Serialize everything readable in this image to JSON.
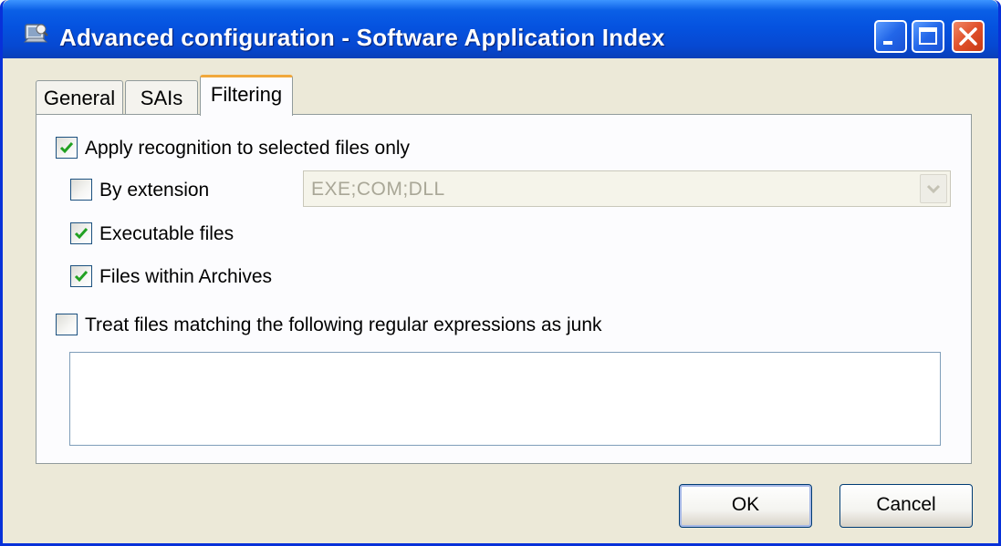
{
  "window": {
    "title": "Advanced configuration - Software Application Index",
    "app_icon": "sai-app-icon",
    "controls": [
      "minimize-icon",
      "maximize-icon",
      "close-icon"
    ]
  },
  "tabs": [
    {
      "label": "General",
      "selected": false
    },
    {
      "label": "SAIs",
      "selected": false
    },
    {
      "label": "Filtering",
      "selected": true
    }
  ],
  "filtering": {
    "apply_recognition": {
      "label": "Apply recognition to selected files only",
      "checked": true
    },
    "by_extension": {
      "label": "By extension",
      "checked": false,
      "value": "EXE;COM;DLL",
      "enabled": false
    },
    "executable_files": {
      "label": "Executable files",
      "checked": true
    },
    "files_within_archives": {
      "label": "Files within Archives",
      "checked": true
    },
    "treat_as_junk": {
      "label": "Treat files matching the following regular expressions as junk",
      "checked": false
    },
    "regex_text": ""
  },
  "buttons": {
    "ok": "OK",
    "cancel": "Cancel"
  },
  "colors": {
    "title_bar": "#0553e0",
    "dialog_bg": "#ece9d8",
    "selected_tab_accent": "#f1a83b",
    "checkmark": "#21a121"
  }
}
